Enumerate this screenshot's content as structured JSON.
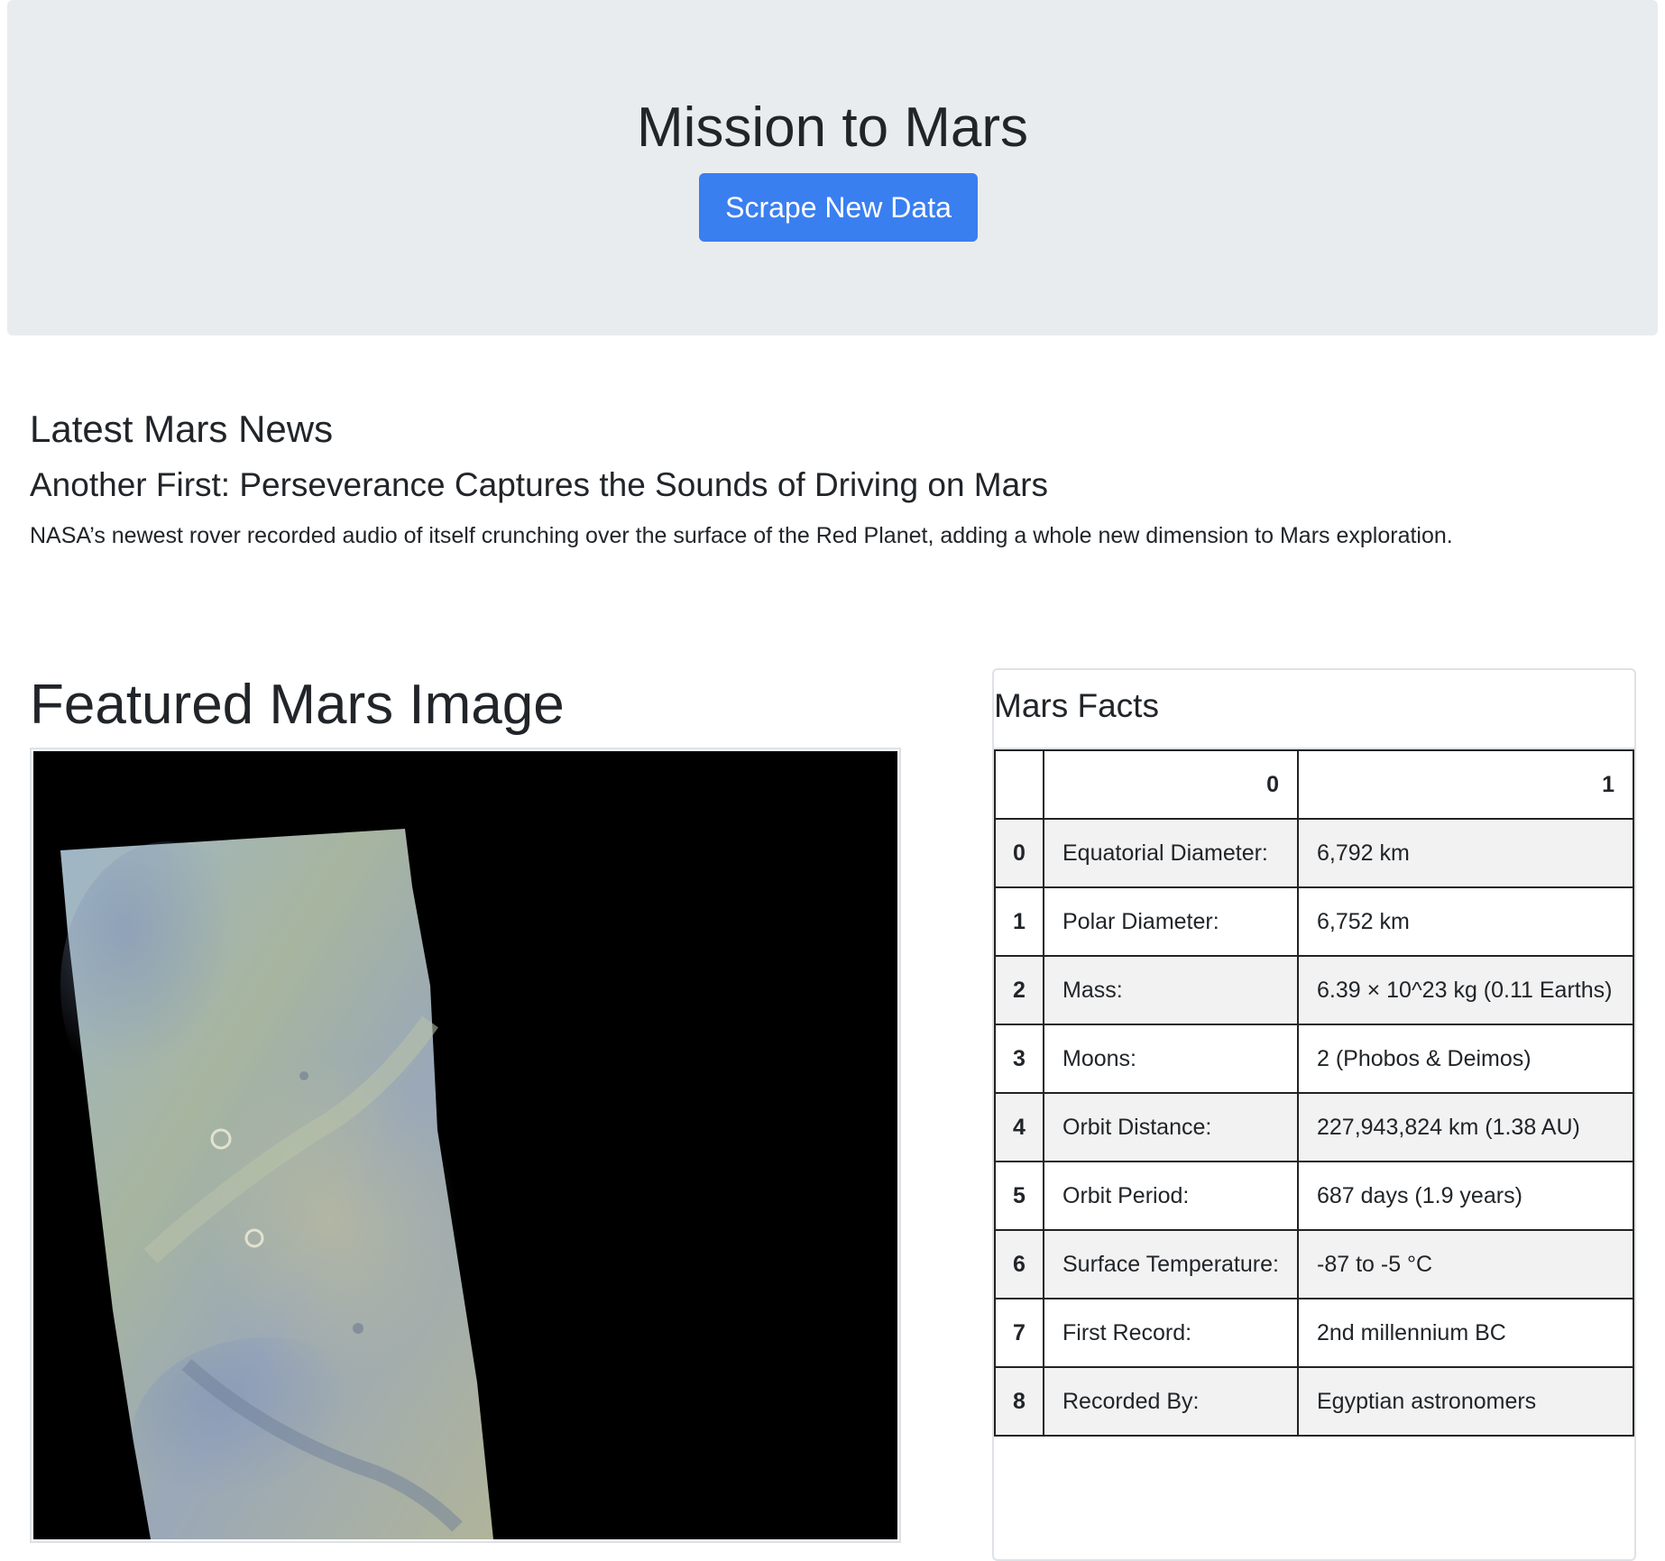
{
  "header": {
    "title": "Mission to Mars",
    "scrape_button_label": "Scrape New Data",
    "accent_color": "#3a7ff0"
  },
  "news": {
    "section_title": "Latest Mars News",
    "headline": "Another First: Perseverance Captures the Sounds of Driving on Mars",
    "teaser": "NASA’s newest rover recorded audio of itself crunching over the surface of the Red Planet, adding a whole new dimension to Mars exploration."
  },
  "featured": {
    "title": "Featured Mars Image"
  },
  "facts": {
    "title": "Mars Facts",
    "column_headers": [
      "",
      "0",
      "1"
    ],
    "rows": [
      {
        "index": "0",
        "label": "Equatorial Diameter:",
        "value": "6,792 km"
      },
      {
        "index": "1",
        "label": "Polar Diameter:",
        "value": "6,752 km"
      },
      {
        "index": "2",
        "label": "Mass:",
        "value": "6.39 × 10^23 kg (0.11 Earths)"
      },
      {
        "index": "3",
        "label": "Moons:",
        "value": "2 (Phobos & Deimos)"
      },
      {
        "index": "4",
        "label": "Orbit Distance:",
        "value": "227,943,824 km (1.38 AU)"
      },
      {
        "index": "5",
        "label": "Orbit Period:",
        "value": "687 days (1.9 years)"
      },
      {
        "index": "6",
        "label": "Surface Temperature:",
        "value": "-87 to -5 °C"
      },
      {
        "index": "7",
        "label": "First Record:",
        "value": "2nd millennium BC"
      },
      {
        "index": "8",
        "label": "Recorded By:",
        "value": "Egyptian astronomers"
      }
    ]
  }
}
